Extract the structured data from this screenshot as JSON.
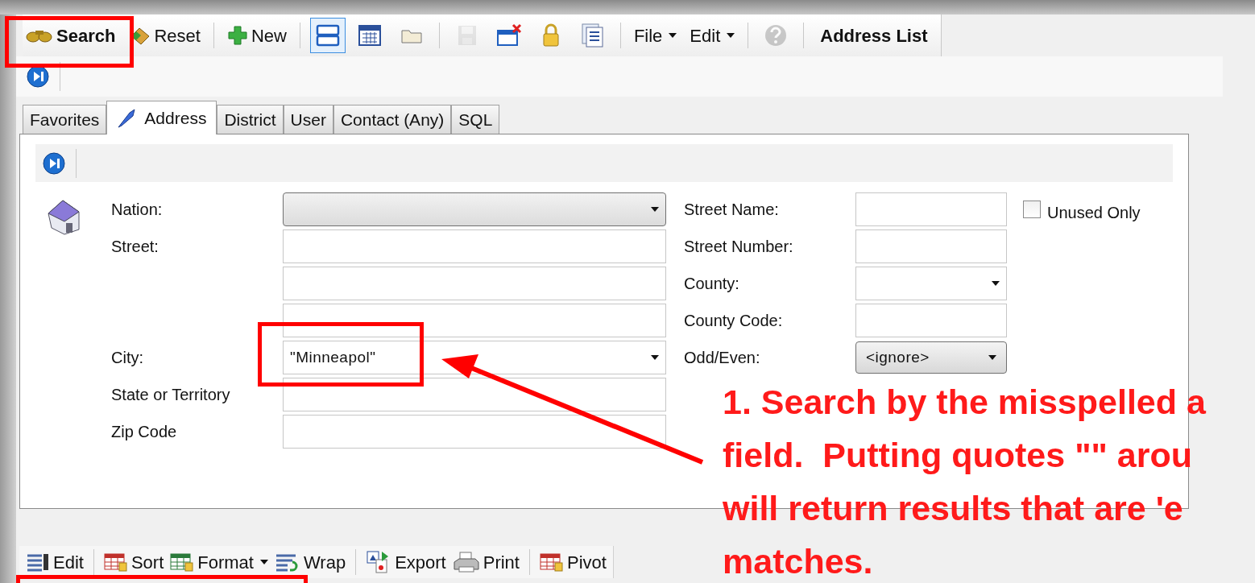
{
  "toolbar": [
    {
      "kind": "primary",
      "label": "Search"
    },
    {
      "kind": "button",
      "label": "Reset"
    },
    {
      "kind": "separator"
    },
    {
      "kind": "button",
      "label": "New"
    },
    {
      "kind": "separator"
    },
    {
      "kind": "icon",
      "selected": true,
      "disabled": false
    },
    {
      "kind": "icon",
      "selected": false,
      "disabled": false
    },
    {
      "kind": "icon",
      "selected": false,
      "disabled": false
    },
    {
      "kind": "separator"
    },
    {
      "kind": "icon",
      "selected": false,
      "disabled": true
    },
    {
      "kind": "icon",
      "selected": false,
      "disabled": false
    },
    {
      "kind": "icon",
      "selected": false,
      "disabled": false
    },
    {
      "kind": "icon",
      "selected": false,
      "disabled": false
    },
    {
      "kind": "separator"
    },
    {
      "kind": "menu",
      "label": "File"
    },
    {
      "kind": "menu",
      "label": "Edit"
    },
    {
      "kind": "separator"
    },
    {
      "kind": "icon",
      "selected": false,
      "disabled": true
    },
    {
      "kind": "separator"
    },
    {
      "kind": "title",
      "label": "Address List"
    }
  ],
  "tabs": [
    {
      "label": "Favorites",
      "selected": false
    },
    {
      "label": "Address",
      "selected": true
    },
    {
      "label": "District",
      "selected": false
    },
    {
      "label": "User",
      "selected": false
    },
    {
      "label": "Contact (Any)",
      "selected": false
    },
    {
      "label": "SQL",
      "selected": false
    }
  ],
  "left_fields": [
    {
      "label": "Nation:",
      "kind": "dropdown",
      "shaded": true
    },
    {
      "label": "Street:",
      "kind": "text"
    },
    {
      "kind": "text"
    },
    {
      "kind": "text"
    },
    {
      "label": "City:",
      "kind": "dropdown",
      "value": "\"Minneapol\"",
      "shaded": false
    },
    {
      "label": "State or Territory",
      "kind": "text"
    },
    {
      "label": "Zip Code",
      "kind": "text"
    }
  ],
  "right_fields": [
    {
      "label": "Street Name:",
      "kind": "text"
    },
    {
      "label": "Street Number:",
      "kind": "text"
    },
    {
      "label": "County:",
      "kind": "dropdown",
      "shaded": false
    },
    {
      "label": "County Code:",
      "kind": "text"
    },
    {
      "label": "Odd/Even:",
      "kind": "select",
      "value": "<ignore>"
    }
  ],
  "unused_only": {
    "label": "Unused Only",
    "checked": false
  },
  "bottom_toolbar": [
    {
      "kind": "button",
      "label": "Edit"
    },
    {
      "kind": "separator"
    },
    {
      "kind": "button",
      "label": "Sort"
    },
    {
      "kind": "menu",
      "label": "Format"
    },
    {
      "kind": "button",
      "label": "Wrap"
    },
    {
      "kind": "separator"
    },
    {
      "kind": "button",
      "label": "Export"
    },
    {
      "kind": "button",
      "label": "Print"
    },
    {
      "kind": "separator"
    },
    {
      "kind": "button",
      "label": "Pivot"
    }
  ],
  "annotation": {
    "lines": [
      "1. Search by the misspelled a",
      "field.  Putting quotes \"\" arou",
      "will return results that are 'e",
      "matches."
    ]
  }
}
